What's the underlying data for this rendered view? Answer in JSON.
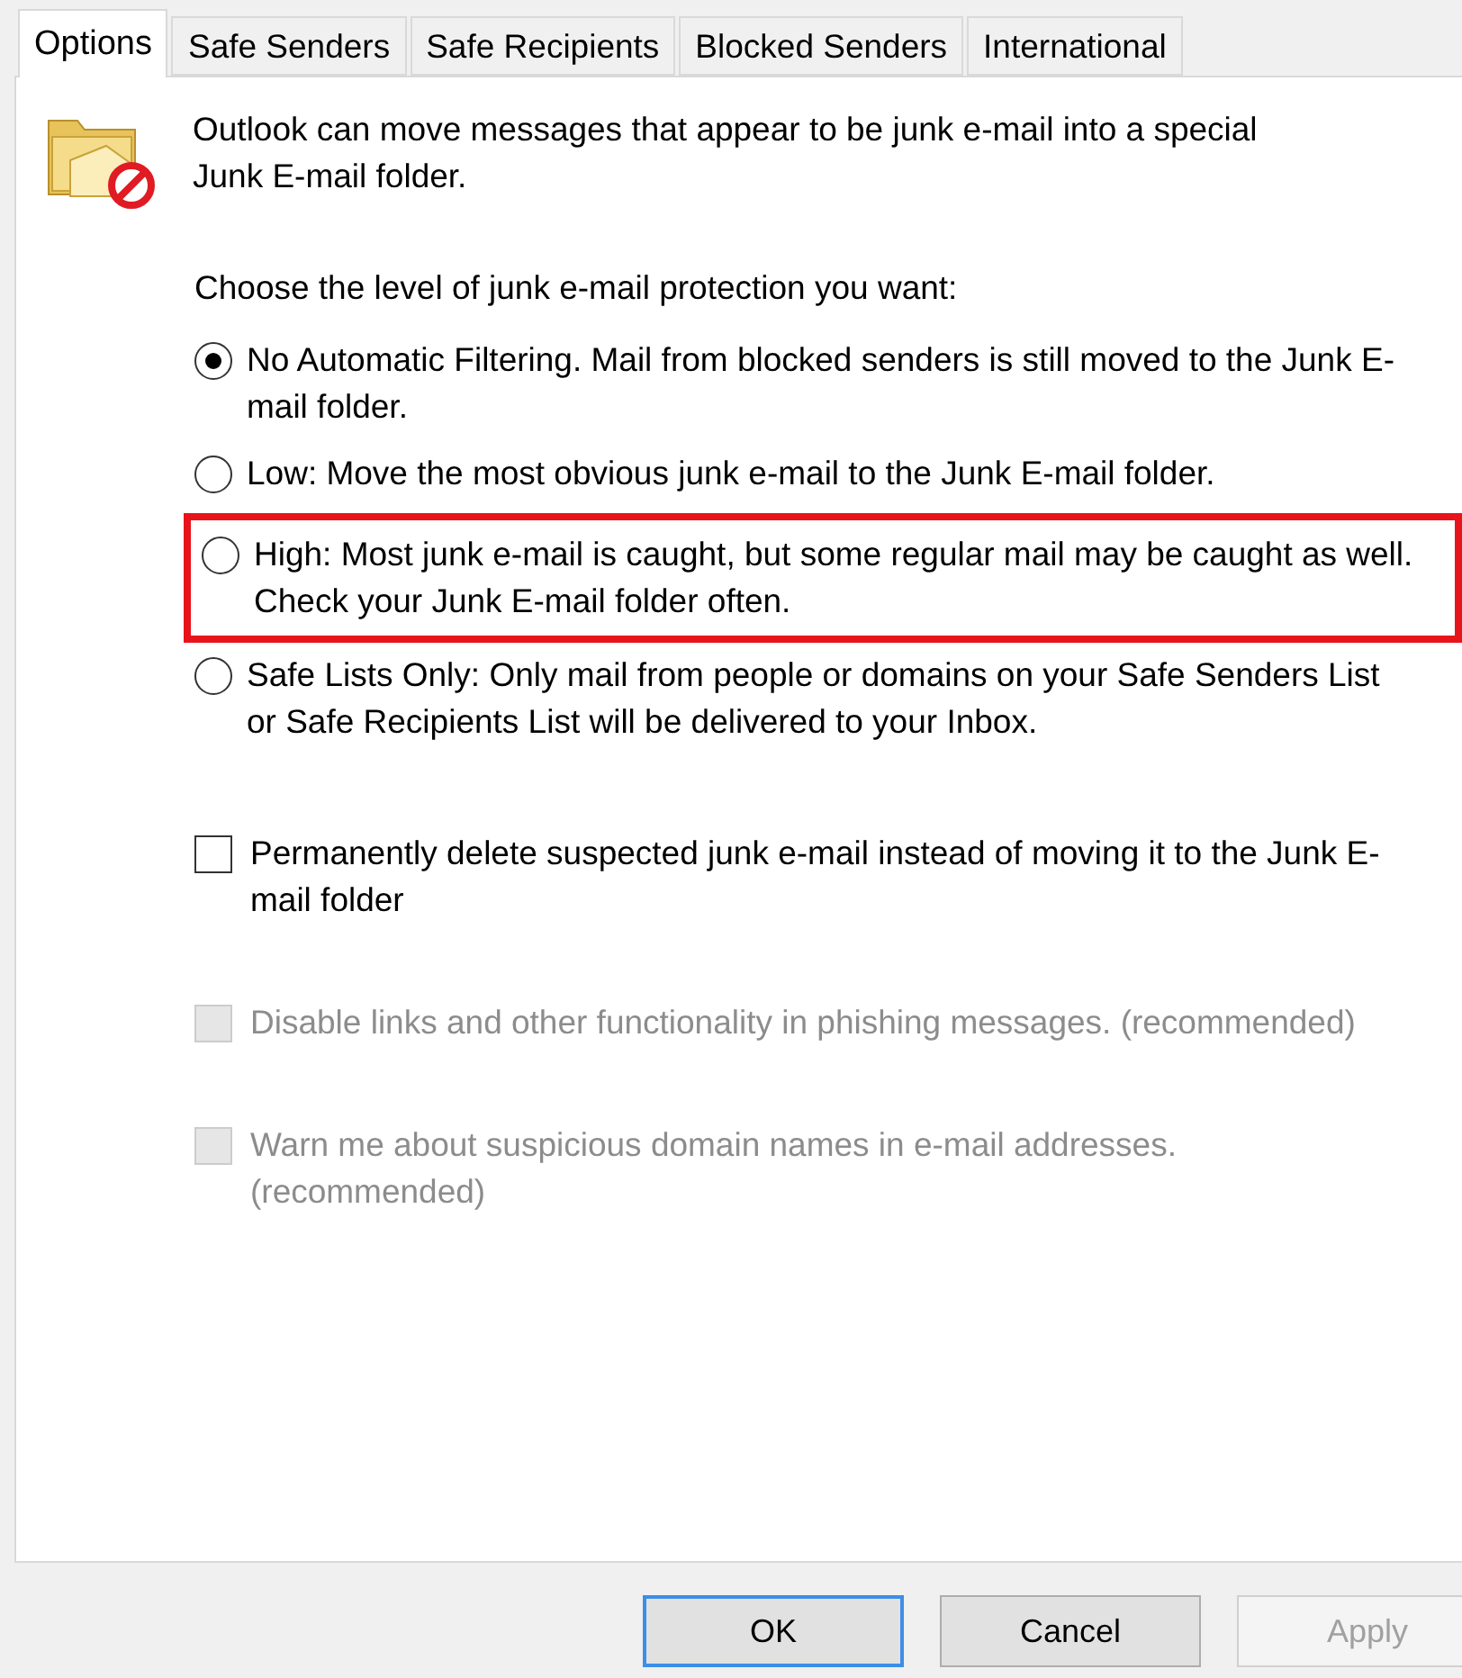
{
  "tabs": [
    {
      "label": "Options",
      "selected": true
    },
    {
      "label": "Safe Senders",
      "selected": false
    },
    {
      "label": "Safe Recipients",
      "selected": false
    },
    {
      "label": "Blocked Senders",
      "selected": false
    },
    {
      "label": "International",
      "selected": false
    }
  ],
  "intro": "Outlook can move messages that appear to be junk e-mail into a special Junk E-mail folder.",
  "level_prompt": "Choose the level of junk e-mail protection you want:",
  "levels": [
    {
      "label": "No Automatic Filtering. Mail from blocked senders is still moved to the Junk E-mail folder.",
      "selected": true,
      "highlighted": false
    },
    {
      "label": "Low: Move the most obvious junk e-mail to the Junk E-mail folder.",
      "selected": false,
      "highlighted": false
    },
    {
      "label": "High: Most junk e-mail is caught, but some regular mail may be caught as well. Check your Junk E-mail folder often.",
      "selected": false,
      "highlighted": true
    },
    {
      "label": "Safe Lists Only: Only mail from people or domains on your Safe Senders List or Safe Recipients List will be delivered to your Inbox.",
      "selected": false,
      "highlighted": false
    }
  ],
  "checkboxes": [
    {
      "label": "Permanently delete suspected junk e-mail instead of moving it to the Junk E-mail folder",
      "checked": false,
      "disabled": false
    },
    {
      "label": "Disable links and other functionality in phishing messages. (recommended)",
      "checked": false,
      "disabled": true
    },
    {
      "label": "Warn me about suspicious domain names in e-mail addresses. (recommended)",
      "checked": false,
      "disabled": true
    }
  ],
  "buttons": [
    {
      "label": "OK",
      "kind": "default",
      "disabled": false
    },
    {
      "label": "Cancel",
      "kind": "normal",
      "disabled": false
    },
    {
      "label": "Apply",
      "kind": "normal",
      "disabled": true
    }
  ]
}
